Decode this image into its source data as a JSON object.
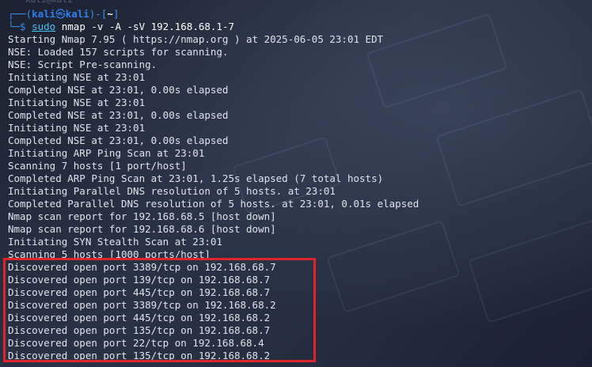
{
  "prompt": {
    "prefix_top": "┌──(",
    "user": "kali",
    "at": "㉿",
    "host": "kali",
    "mid": ")-[",
    "cwd": "~",
    "suffix": "]",
    "prefix_bottom": "└─$",
    "sudo": "sudo",
    "command": "nmap -v -A -sV 192.168.68.1-7"
  },
  "ghost_text": "kali@kali",
  "output": [
    "Starting Nmap 7.95 ( https://nmap.org ) at 2025-06-05 23:01 EDT",
    "NSE: Loaded 157 scripts for scanning.",
    "NSE: Script Pre-scanning.",
    "Initiating NSE at 23:01",
    "Completed NSE at 23:01, 0.00s elapsed",
    "Initiating NSE at 23:01",
    "Completed NSE at 23:01, 0.00s elapsed",
    "Initiating NSE at 23:01",
    "Completed NSE at 23:01, 0.00s elapsed",
    "Initiating ARP Ping Scan at 23:01",
    "Scanning 7 hosts [1 port/host]",
    "Completed ARP Ping Scan at 23:01, 1.25s elapsed (7 total hosts)",
    "Initiating Parallel DNS resolution of 5 hosts. at 23:01",
    "Completed Parallel DNS resolution of 5 hosts. at 23:01, 0.01s elapsed",
    "Nmap scan report for 192.168.68.5 [host down]",
    "Nmap scan report for 192.168.68.6 [host down]",
    "Initiating SYN Stealth Scan at 23:01",
    "Scanning 5 hosts [1000 ports/host]",
    "Discovered open port 3389/tcp on 192.168.68.7",
    "Discovered open port 139/tcp on 192.168.68.7",
    "Discovered open port 445/tcp on 192.168.68.7",
    "Discovered open port 3389/tcp on 192.168.68.2",
    "Discovered open port 445/tcp on 192.168.68.2",
    "Discovered open port 135/tcp on 192.168.68.7",
    "Discovered open port 22/tcp on 192.168.68.4",
    "Discovered open port 135/tcp on 192.168.68.2"
  ],
  "colors": {
    "prompt_blue": "#2f7ef2",
    "highlight_red": "#e0242b",
    "text": "#dfe3ea"
  }
}
